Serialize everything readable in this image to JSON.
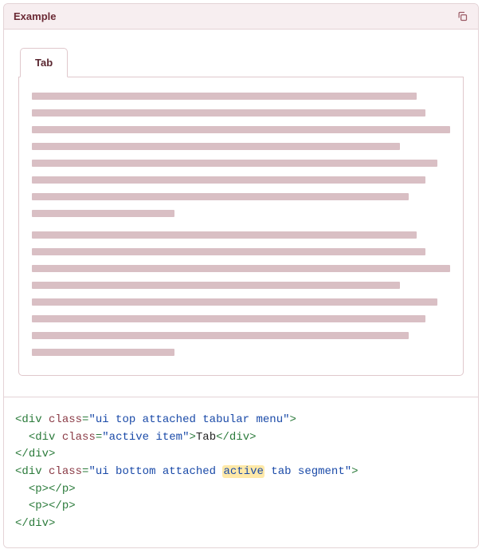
{
  "header": {
    "title": "Example",
    "copy_icon": "copy-icon"
  },
  "preview": {
    "tab_label": "Tab",
    "paragraphs": [
      {
        "lines": [
          "92%",
          "94%",
          "100%",
          "88%",
          "97%",
          "94%",
          "90%",
          "34%"
        ]
      },
      {
        "lines": [
          "92%",
          "94%",
          "100%",
          "88%",
          "97%",
          "94%",
          "90%",
          "34%"
        ]
      }
    ]
  },
  "code": {
    "lines": [
      {
        "indent": 0,
        "type": "open",
        "tag": "div",
        "attrs": [
          {
            "name": "class",
            "value": "ui top attached tabular menu"
          }
        ]
      },
      {
        "indent": 1,
        "type": "openclose",
        "tag": "div",
        "attrs": [
          {
            "name": "class",
            "value": "active item"
          }
        ],
        "text": "Tab"
      },
      {
        "indent": 0,
        "type": "close",
        "tag": "div"
      },
      {
        "indent": 0,
        "type": "open",
        "tag": "div",
        "attrs": [
          {
            "name": "class",
            "value": "ui bottom attached active tab segment",
            "highlight": "active"
          }
        ]
      },
      {
        "indent": 1,
        "type": "empty",
        "tag": "p"
      },
      {
        "indent": 1,
        "type": "empty",
        "tag": "p"
      },
      {
        "indent": 0,
        "type": "close",
        "tag": "div"
      }
    ]
  }
}
